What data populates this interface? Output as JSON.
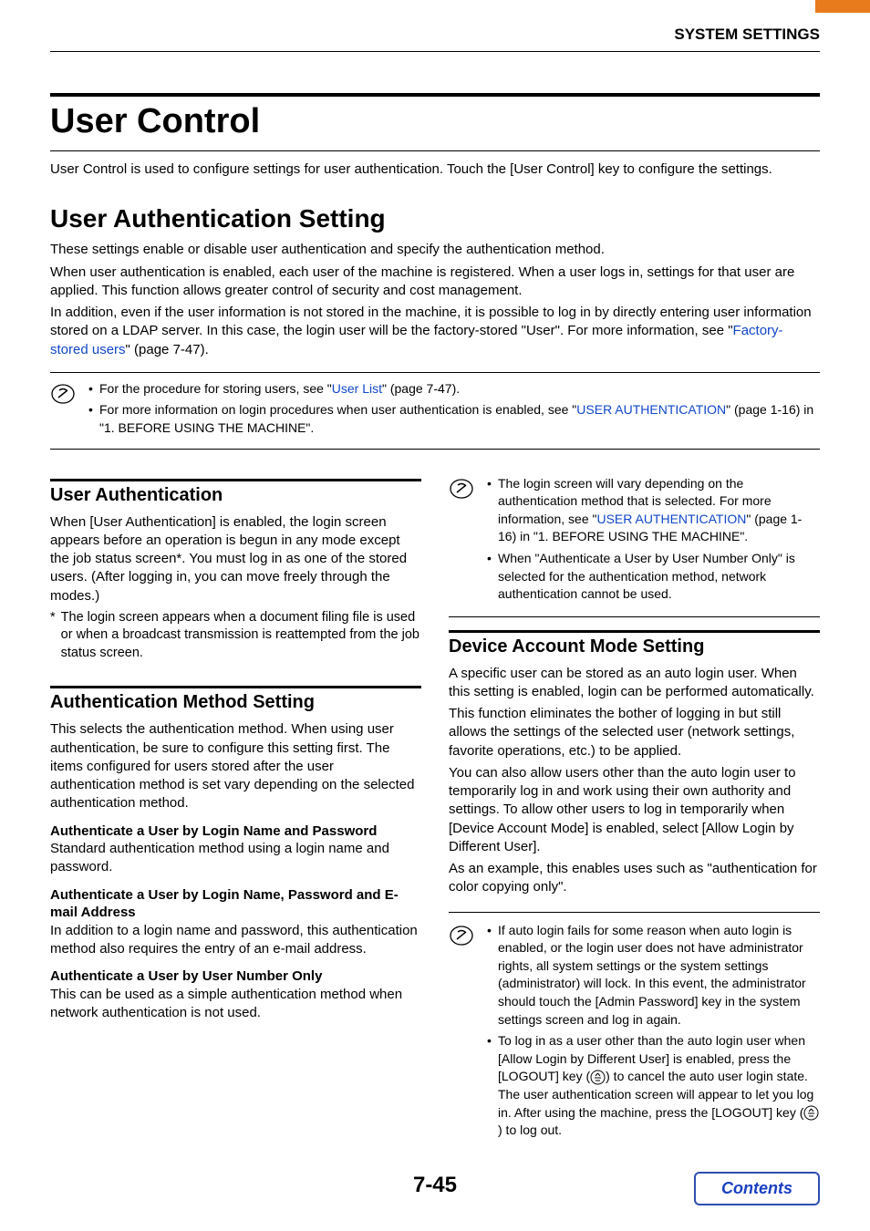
{
  "header": {
    "title": "SYSTEM SETTINGS"
  },
  "h1": "User Control",
  "intro": "User Control is used to configure settings for user authentication. Touch the [User Control] key to configure the settings.",
  "section1": {
    "title": "User Authentication Setting",
    "p1": "These settings enable or disable user authentication and specify the authentication method.",
    "p2": "When user authentication is enabled, each user of the machine is registered. When a user logs in, settings for that user are applied. This function allows greater control of security and cost management.",
    "p3_a": "In addition, even if the user information is not stored in the machine, it is possible to log in by directly entering user information stored on a LDAP server. In this case, the login user will be the factory-stored \"User\". For more information, see \"",
    "p3_link": "Factory-stored users",
    "p3_b": "\" (page 7-47).",
    "note1_a": "For the procedure for storing users, see \"",
    "note1_link": "User List",
    "note1_b": "\" (page 7-47).",
    "note2_a": "For more information on login procedures when user authentication is enabled, see \"",
    "note2_link": "USER AUTHENTICATION",
    "note2_b": "\" (page 1-16) in \"1. BEFORE USING THE MACHINE\"."
  },
  "left": {
    "ua_title": "User Authentication",
    "ua_body": "When [User Authentication] is enabled, the login screen appears before an operation is begun in any mode except the job status screen*. You must log in as one of the stored users. (After logging in, you can move freely through the modes.)",
    "ua_star": "*",
    "ua_foot": "The login screen appears when a document filing file is used or when a broadcast transmission is reattempted from the job status screen.",
    "am_title": "Authentication Method Setting",
    "am_body": "This selects the authentication method. When using user authentication, be sure to configure this setting first. The items configured for users stored after the user authentication method is set vary depending on the selected authentication method.",
    "am_h1": "Authenticate a User by Login Name and Password",
    "am_p1": "Standard authentication method using a login name and password.",
    "am_h2": "Authenticate a User by Login Name, Password and E-mail Address",
    "am_p2": "In addition to a login name and password, this authentication method also requires the entry of an e-mail address.",
    "am_h3": "Authenticate a User by User Number Only",
    "am_p3": "This can be used as a simple authentication method when network authentication is not used."
  },
  "right": {
    "nb1_a": "The login screen will vary depending on the authentication method that is selected. For more information, see \"",
    "nb1_link": "USER AUTHENTICATION",
    "nb1_b": "\" (page 1-16) in \"1. BEFORE USING THE MACHINE\".",
    "nb2": "When \"Authenticate a User by User Number Only\" is selected for the authentication method, network authentication cannot be used.",
    "dam_title": "Device Account Mode Setting",
    "dam_p1": "A specific user can be stored as an auto login user. When this setting is enabled, login can be performed automatically.",
    "dam_p2": "This function eliminates the bother of logging in but still allows the settings of the selected user (network settings, favorite operations, etc.) to be applied.",
    "dam_p3": "You can also allow users other than the auto login user to temporarily log in and work using their own authority and settings. To allow other users to log in temporarily when [Device Account Mode] is enabled, select [Allow Login by Different User].",
    "dam_p4": "As an example, this enables uses such as \"authentication for color copying only\".",
    "nb3": "If auto login fails for some reason when auto login is enabled, or the login user does not have administrator rights, all system settings or the system settings (administrator) will lock. In this event, the administrator should touch the [Admin Password] key in the system settings screen and log in again.",
    "nb4_a": "To log in as a user other than the auto login user when [Allow Login by Different User] is enabled, press the [LOGOUT] key (",
    "nb4_b": ") to cancel the auto user login state. The user authentication screen will appear to let you log in. After using the machine, press the [LOGOUT] key (",
    "nb4_c": ") to log out."
  },
  "footer": {
    "page": "7-45",
    "contents": "Contents"
  }
}
